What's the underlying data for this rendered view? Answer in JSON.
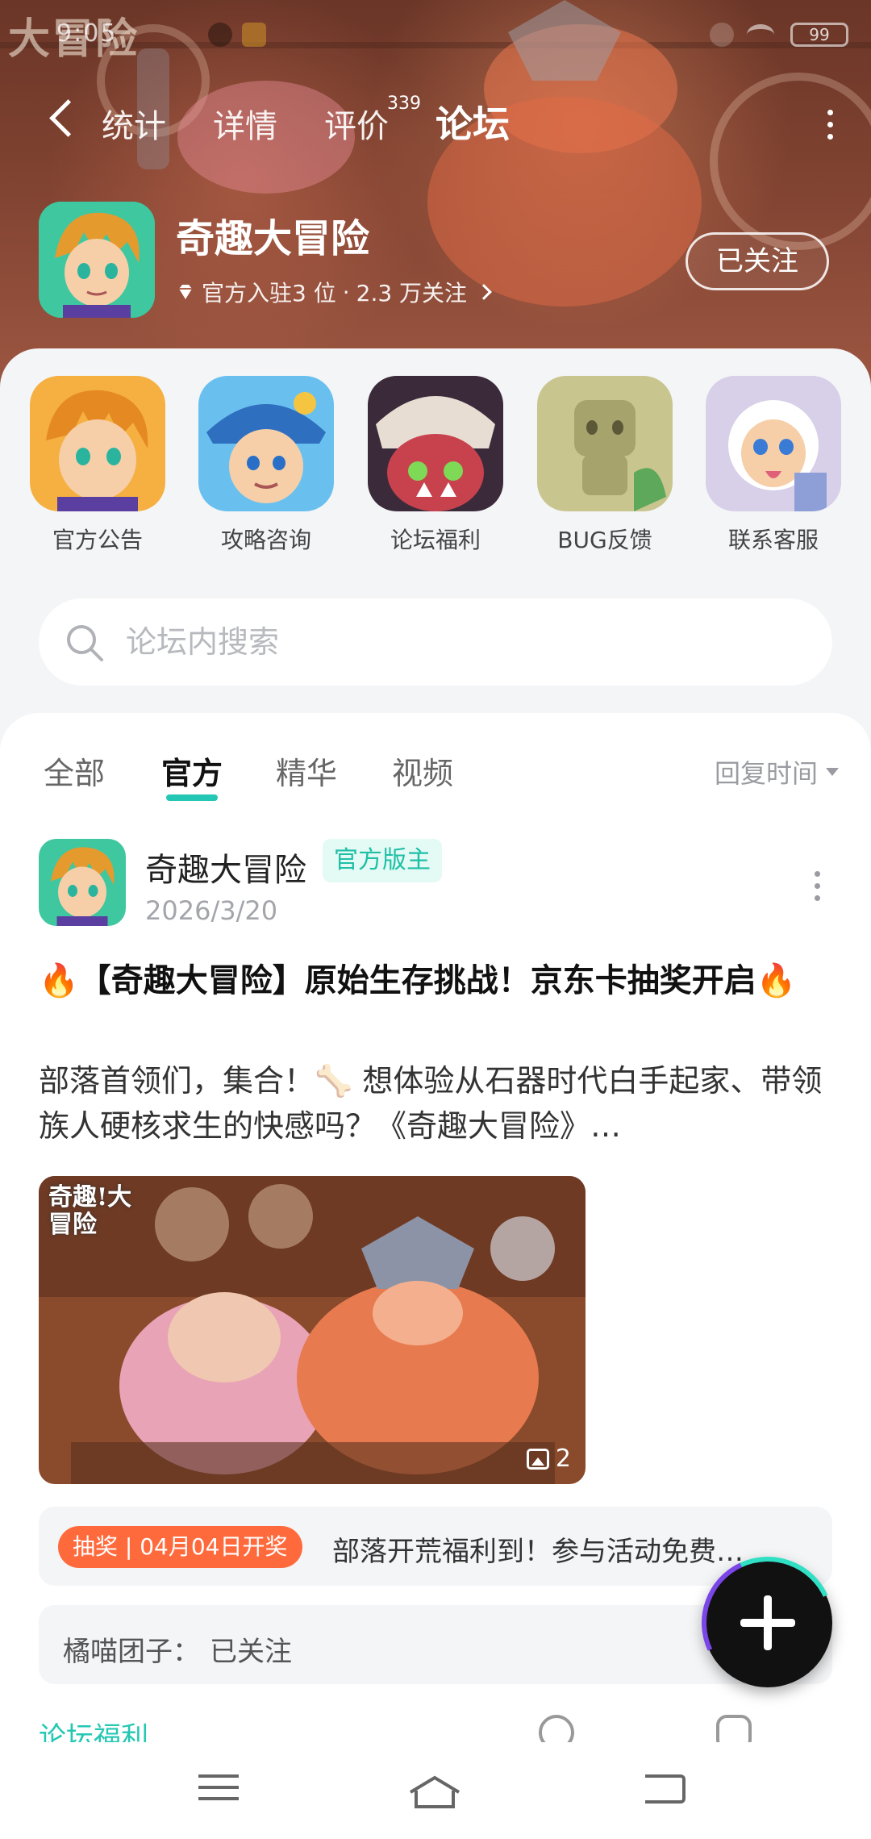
{
  "status_bar": {
    "logo_text": "大冒险",
    "time": "9:05",
    "battery": "99"
  },
  "nav": {
    "tabs": [
      "统计",
      "详情",
      "评价",
      "论坛"
    ],
    "active_tab": "论坛",
    "review_count": "339"
  },
  "game": {
    "title": "奇趣大冒险",
    "meta_official": "官方入驻3 位",
    "meta_sep": "·",
    "meta_followers": "2.3 万关注",
    "follow_label": "已关注"
  },
  "quick_links": [
    {
      "label": "官方公告",
      "icon": "announcement-icon",
      "bg": "#f5b041"
    },
    {
      "label": "攻略咨询",
      "icon": "guide-icon",
      "bg": "#5aa7e8"
    },
    {
      "label": "论坛福利",
      "icon": "welfare-icon",
      "bg": "#d7525a"
    },
    {
      "label": "BUG反馈",
      "icon": "bug-report-icon",
      "bg": "#c9c58f"
    },
    {
      "label": "联系客服",
      "icon": "customer-service-icon",
      "bg": "#f0e6f5"
    }
  ],
  "search": {
    "placeholder": "论坛内搜索"
  },
  "filters": {
    "tabs": [
      "全部",
      "官方",
      "精华",
      "视频"
    ],
    "active": "官方",
    "sort_label": "回复时间"
  },
  "post": {
    "author": "奇趣大冒险",
    "badge": "官方版主",
    "date": "2026/3/20",
    "title": "🔥【奇趣大冒险】原始生存挑战！京东卡抽奖开启🔥",
    "excerpt": "部落首领们，集合！🦴 想体验从石器时代白手起家、带领族人硬核求生的快感吗？《奇趣大冒险》…",
    "image_logo": "奇趣!大冒险",
    "image_count": "2",
    "promo_tag": "抽奖 | 04月04日开奖",
    "promo_text": "部落开荒福利到！参与活动免费…",
    "comment_name": "橘喵团子：",
    "comment_text": "已关注",
    "foot_tag": "论坛福利"
  },
  "colors": {
    "accent": "#23c7b3",
    "promo": "#ff6a3d",
    "banner": "#8c4a36"
  }
}
